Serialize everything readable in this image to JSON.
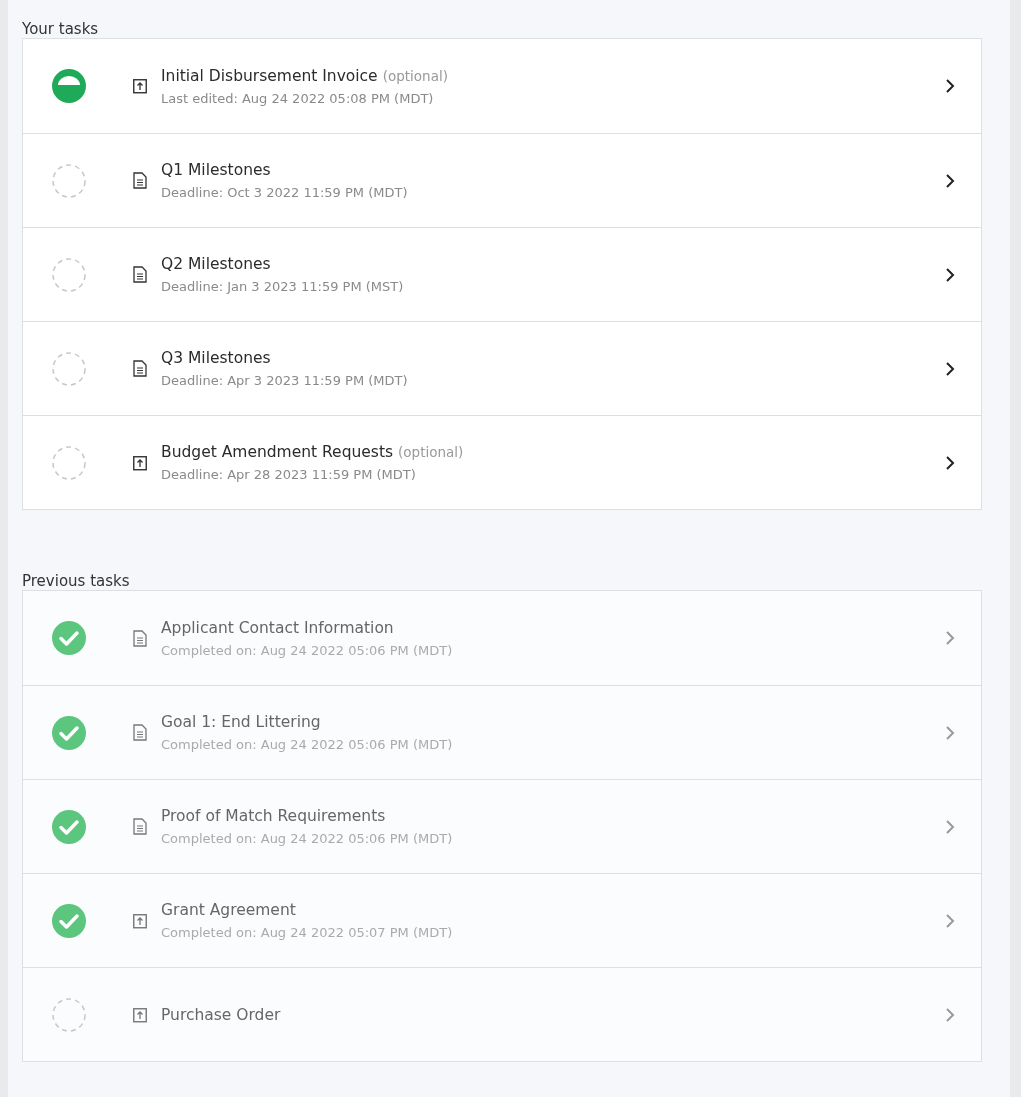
{
  "sections": [
    {
      "heading": "Your tasks",
      "muted": false,
      "tasks": [
        {
          "kind": "in_progress",
          "doc": {
            "kind": "upload"
          },
          "title": "Initial Disbursement Invoice",
          "note": "(optional)",
          "subtitle": "Last edited: Aug 24 2022 05:08 PM (MDT)"
        },
        {
          "kind": "not_started",
          "doc": {
            "kind": "form"
          },
          "title": "Q1 Milestones",
          "subtitle": "Deadline: Oct 3 2022 11:59 PM (MDT)"
        },
        {
          "kind": "not_started",
          "doc": {
            "kind": "form"
          },
          "title": "Q2 Milestones",
          "subtitle": "Deadline: Jan 3 2023 11:59 PM (MST)"
        },
        {
          "kind": "not_started",
          "doc": {
            "kind": "form"
          },
          "title": "Q3 Milestones",
          "subtitle": "Deadline: Apr 3 2023 11:59 PM (MDT)"
        },
        {
          "kind": "not_started",
          "doc": {
            "kind": "upload"
          },
          "title": "Budget Amendment Requests",
          "note": "(optional)",
          "subtitle": "Deadline: Apr 28 2023 11:59 PM (MDT)"
        }
      ]
    },
    {
      "heading": "Previous tasks",
      "muted": true,
      "tasks": [
        {
          "kind": "done",
          "doc": {
            "kind": "form"
          },
          "title": "Applicant Contact Information",
          "subtitle": "Completed on: Aug 24 2022 05:06 PM (MDT)"
        },
        {
          "kind": "done",
          "doc": {
            "kind": "form"
          },
          "title": "Goal 1: End Littering",
          "subtitle": "Completed on: Aug 24 2022 05:06 PM (MDT)"
        },
        {
          "kind": "done",
          "doc": {
            "kind": "form"
          },
          "title": "Proof of Match Requirements",
          "subtitle": "Completed on: Aug 24 2022 05:06 PM (MDT)"
        },
        {
          "kind": "done",
          "doc": {
            "kind": "upload"
          },
          "title": "Grant Agreement",
          "subtitle": "Completed on: Aug 24 2022 05:07 PM (MDT)"
        },
        {
          "kind": "not_started",
          "doc": {
            "kind": "upload"
          },
          "title": "Purchase Order"
        }
      ]
    }
  ]
}
